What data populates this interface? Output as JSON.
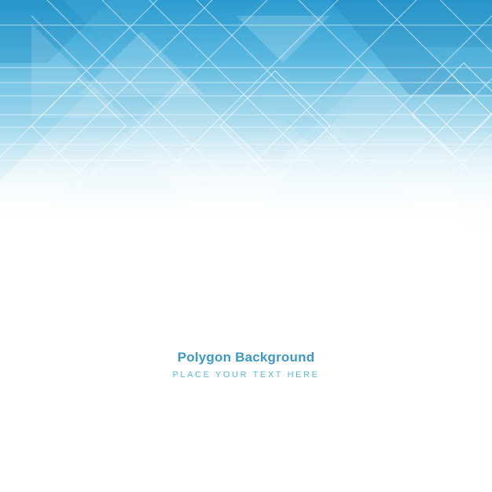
{
  "content": {
    "title": "Polygon Background",
    "subtitle": "PLACE YOUR TEXT HERE"
  },
  "colors": {
    "background": "#ffffff",
    "primary_blue": "#2f9fd0",
    "light_blue": "#bfe6f3",
    "title": "#3c9ac2",
    "subtitle": "#5bb9d6"
  }
}
